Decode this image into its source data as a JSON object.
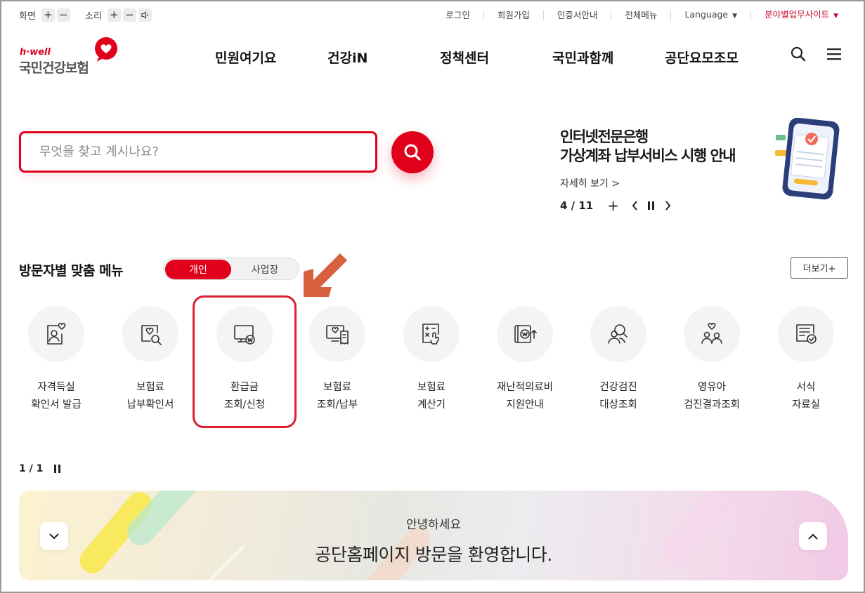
{
  "utility": {
    "screen_label": "화면",
    "sound_label": "소리",
    "plus": "+",
    "minus": "−",
    "links": [
      "로그인",
      "회원가입",
      "인증서안내",
      "전체메뉴",
      "Language"
    ],
    "field_sites": "분야별업무사이트"
  },
  "logo": {
    "en": "h·well",
    "ko": "국민건강보험"
  },
  "gnb": [
    "민원여기요",
    "건강iN",
    "정책센터",
    "국민과함께",
    "공단요모조모"
  ],
  "search": {
    "placeholder": "무엇을 찾고 계시나요?"
  },
  "banner": {
    "title_line1": "인터넷전문은행",
    "title_line2": "가상계좌 납부서비스 시행 안내",
    "more": "자세히 보기 >",
    "counter": "4 / 11",
    "plus": "+"
  },
  "custom_menu": {
    "title": "방문자별 맞춤 메뉴",
    "tab_personal": "개인",
    "tab_business": "사업장",
    "more": "더보기+",
    "items": [
      {
        "line1": "자격득실",
        "line2": "확인서 발급",
        "icon": "id-card-heart-icon"
      },
      {
        "line1": "보험료",
        "line2": "납부확인서",
        "icon": "document-search-icon"
      },
      {
        "line1": "환급금",
        "line2": "조회/신청",
        "icon": "monitor-won-icon"
      },
      {
        "line1": "보험료",
        "line2": "조회/납부",
        "icon": "monitor-receipt-icon"
      },
      {
        "line1": "보험료",
        "line2": "계산기",
        "icon": "calculator-icon"
      },
      {
        "line1": "재난적의료비",
        "line2": "지원안내",
        "icon": "wallet-won-icon"
      },
      {
        "line1": "건강검진",
        "line2": "대상조회",
        "icon": "people-search-icon"
      },
      {
        "line1": "영유아",
        "line2": "검진결과조회",
        "icon": "family-heart-icon"
      },
      {
        "line1": "서식",
        "line2": "자료실",
        "icon": "form-check-icon"
      }
    ],
    "pager": "1 / 1"
  },
  "welcome": {
    "sub": "안녕하세요",
    "main": "공단홈페이지 방문을 환영합니다."
  },
  "colors": {
    "brand_red": "#e0001b",
    "highlight_red": "#dd2131",
    "arrow_orange": "#d9603f"
  }
}
